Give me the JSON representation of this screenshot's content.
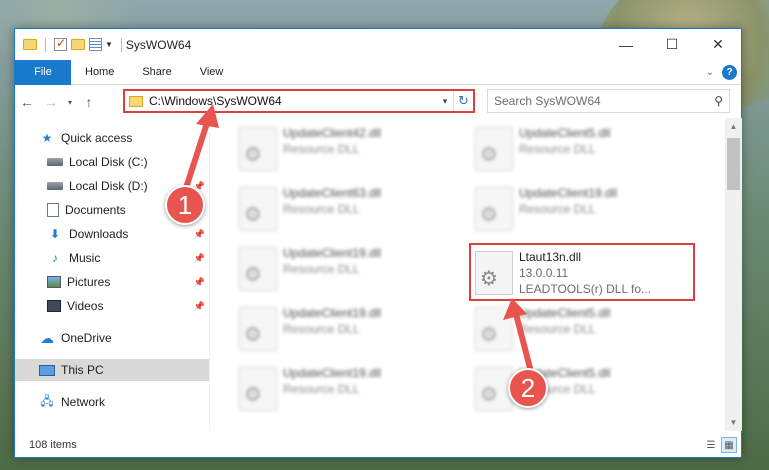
{
  "window": {
    "title": "SysWOW64",
    "controls": {
      "minimize": "—",
      "maximize": "☐",
      "close": "✕"
    }
  },
  "ribbon": {
    "tabs": [
      "File",
      "Home",
      "Share",
      "View"
    ],
    "help_label": "?"
  },
  "nav": {
    "back": "←",
    "forward": "→",
    "recent": "▾",
    "up": "↑"
  },
  "address": {
    "path": "C:\\Windows\\SysWOW64",
    "refresh": "↻"
  },
  "search": {
    "placeholder": "Search SysWOW64"
  },
  "sidebar": {
    "items": [
      {
        "label": "Quick access",
        "icon": "star-icon",
        "pinned": false
      },
      {
        "label": "Local Disk (C:)",
        "icon": "drive-icon",
        "pinned": false
      },
      {
        "label": "Local Disk (D:)",
        "icon": "drive-icon",
        "pinned": true
      },
      {
        "label": "Documents",
        "icon": "documents-icon",
        "pinned": true
      },
      {
        "label": "Downloads",
        "icon": "downloads-icon",
        "pinned": true
      },
      {
        "label": "Music",
        "icon": "music-icon",
        "pinned": true
      },
      {
        "label": "Pictures",
        "icon": "pictures-icon",
        "pinned": true
      },
      {
        "label": "Videos",
        "icon": "videos-icon",
        "pinned": true
      },
      {
        "label": "OneDrive",
        "icon": "onedrive-icon",
        "pinned": false
      },
      {
        "label": "This PC",
        "icon": "this-pc-icon",
        "pinned": false,
        "selected": true
      },
      {
        "label": "Network",
        "icon": "network-icon",
        "pinned": false
      }
    ]
  },
  "files": {
    "left_column": [
      {
        "name": "UpdateClient42.dll",
        "type": "Resource DLL"
      },
      {
        "name": "UpdateClient63.dll",
        "type": "Resource DLL"
      },
      {
        "name": "UpdateClient19.dll",
        "type": "Resource DLL"
      },
      {
        "name": "UpdateClient19.dll",
        "type": "Resource DLL"
      },
      {
        "name": "UpdateClient19.dll",
        "type": "Resource DLL"
      }
    ],
    "right_column": [
      {
        "name": "UpdateClient5.dll",
        "type": "Resource DLL"
      },
      {
        "name": "UpdateClient19.dll",
        "type": "Resource DLL"
      },
      {
        "name": "Ltaut13n.dll",
        "version": "13.0.0.11",
        "description": "LEADTOOLS(r) DLL fo...",
        "highlighted": true
      },
      {
        "name": "UpdateClient5.dll",
        "type": "Resource DLL"
      },
      {
        "name": "UpdateClient5.dll",
        "type": "Resource DLL"
      }
    ]
  },
  "status": {
    "item_count": "108 items"
  },
  "callouts": {
    "one": "1",
    "two": "2"
  },
  "colors": {
    "accent": "#1979ca",
    "highlight": "#e03e3e",
    "callout": "#e8554f"
  }
}
